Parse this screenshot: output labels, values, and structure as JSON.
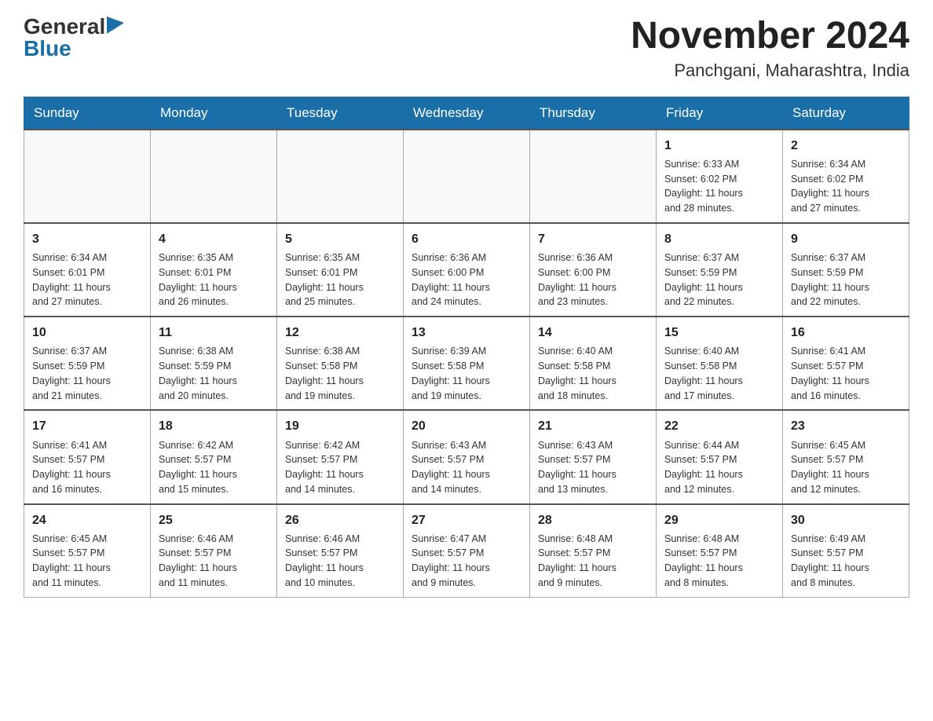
{
  "logo": {
    "general": "General",
    "blue": "Blue"
  },
  "title": "November 2024",
  "location": "Panchgani, Maharashtra, India",
  "days_of_week": [
    "Sunday",
    "Monday",
    "Tuesday",
    "Wednesday",
    "Thursday",
    "Friday",
    "Saturday"
  ],
  "weeks": [
    [
      {
        "day": "",
        "info": ""
      },
      {
        "day": "",
        "info": ""
      },
      {
        "day": "",
        "info": ""
      },
      {
        "day": "",
        "info": ""
      },
      {
        "day": "",
        "info": ""
      },
      {
        "day": "1",
        "info": "Sunrise: 6:33 AM\nSunset: 6:02 PM\nDaylight: 11 hours\nand 28 minutes."
      },
      {
        "day": "2",
        "info": "Sunrise: 6:34 AM\nSunset: 6:02 PM\nDaylight: 11 hours\nand 27 minutes."
      }
    ],
    [
      {
        "day": "3",
        "info": "Sunrise: 6:34 AM\nSunset: 6:01 PM\nDaylight: 11 hours\nand 27 minutes."
      },
      {
        "day": "4",
        "info": "Sunrise: 6:35 AM\nSunset: 6:01 PM\nDaylight: 11 hours\nand 26 minutes."
      },
      {
        "day": "5",
        "info": "Sunrise: 6:35 AM\nSunset: 6:01 PM\nDaylight: 11 hours\nand 25 minutes."
      },
      {
        "day": "6",
        "info": "Sunrise: 6:36 AM\nSunset: 6:00 PM\nDaylight: 11 hours\nand 24 minutes."
      },
      {
        "day": "7",
        "info": "Sunrise: 6:36 AM\nSunset: 6:00 PM\nDaylight: 11 hours\nand 23 minutes."
      },
      {
        "day": "8",
        "info": "Sunrise: 6:37 AM\nSunset: 5:59 PM\nDaylight: 11 hours\nand 22 minutes."
      },
      {
        "day": "9",
        "info": "Sunrise: 6:37 AM\nSunset: 5:59 PM\nDaylight: 11 hours\nand 22 minutes."
      }
    ],
    [
      {
        "day": "10",
        "info": "Sunrise: 6:37 AM\nSunset: 5:59 PM\nDaylight: 11 hours\nand 21 minutes."
      },
      {
        "day": "11",
        "info": "Sunrise: 6:38 AM\nSunset: 5:59 PM\nDaylight: 11 hours\nand 20 minutes."
      },
      {
        "day": "12",
        "info": "Sunrise: 6:38 AM\nSunset: 5:58 PM\nDaylight: 11 hours\nand 19 minutes."
      },
      {
        "day": "13",
        "info": "Sunrise: 6:39 AM\nSunset: 5:58 PM\nDaylight: 11 hours\nand 19 minutes."
      },
      {
        "day": "14",
        "info": "Sunrise: 6:40 AM\nSunset: 5:58 PM\nDaylight: 11 hours\nand 18 minutes."
      },
      {
        "day": "15",
        "info": "Sunrise: 6:40 AM\nSunset: 5:58 PM\nDaylight: 11 hours\nand 17 minutes."
      },
      {
        "day": "16",
        "info": "Sunrise: 6:41 AM\nSunset: 5:57 PM\nDaylight: 11 hours\nand 16 minutes."
      }
    ],
    [
      {
        "day": "17",
        "info": "Sunrise: 6:41 AM\nSunset: 5:57 PM\nDaylight: 11 hours\nand 16 minutes."
      },
      {
        "day": "18",
        "info": "Sunrise: 6:42 AM\nSunset: 5:57 PM\nDaylight: 11 hours\nand 15 minutes."
      },
      {
        "day": "19",
        "info": "Sunrise: 6:42 AM\nSunset: 5:57 PM\nDaylight: 11 hours\nand 14 minutes."
      },
      {
        "day": "20",
        "info": "Sunrise: 6:43 AM\nSunset: 5:57 PM\nDaylight: 11 hours\nand 14 minutes."
      },
      {
        "day": "21",
        "info": "Sunrise: 6:43 AM\nSunset: 5:57 PM\nDaylight: 11 hours\nand 13 minutes."
      },
      {
        "day": "22",
        "info": "Sunrise: 6:44 AM\nSunset: 5:57 PM\nDaylight: 11 hours\nand 12 minutes."
      },
      {
        "day": "23",
        "info": "Sunrise: 6:45 AM\nSunset: 5:57 PM\nDaylight: 11 hours\nand 12 minutes."
      }
    ],
    [
      {
        "day": "24",
        "info": "Sunrise: 6:45 AM\nSunset: 5:57 PM\nDaylight: 11 hours\nand 11 minutes."
      },
      {
        "day": "25",
        "info": "Sunrise: 6:46 AM\nSunset: 5:57 PM\nDaylight: 11 hours\nand 11 minutes."
      },
      {
        "day": "26",
        "info": "Sunrise: 6:46 AM\nSunset: 5:57 PM\nDaylight: 11 hours\nand 10 minutes."
      },
      {
        "day": "27",
        "info": "Sunrise: 6:47 AM\nSunset: 5:57 PM\nDaylight: 11 hours\nand 9 minutes."
      },
      {
        "day": "28",
        "info": "Sunrise: 6:48 AM\nSunset: 5:57 PM\nDaylight: 11 hours\nand 9 minutes."
      },
      {
        "day": "29",
        "info": "Sunrise: 6:48 AM\nSunset: 5:57 PM\nDaylight: 11 hours\nand 8 minutes."
      },
      {
        "day": "30",
        "info": "Sunrise: 6:49 AM\nSunset: 5:57 PM\nDaylight: 11 hours\nand 8 minutes."
      }
    ]
  ]
}
